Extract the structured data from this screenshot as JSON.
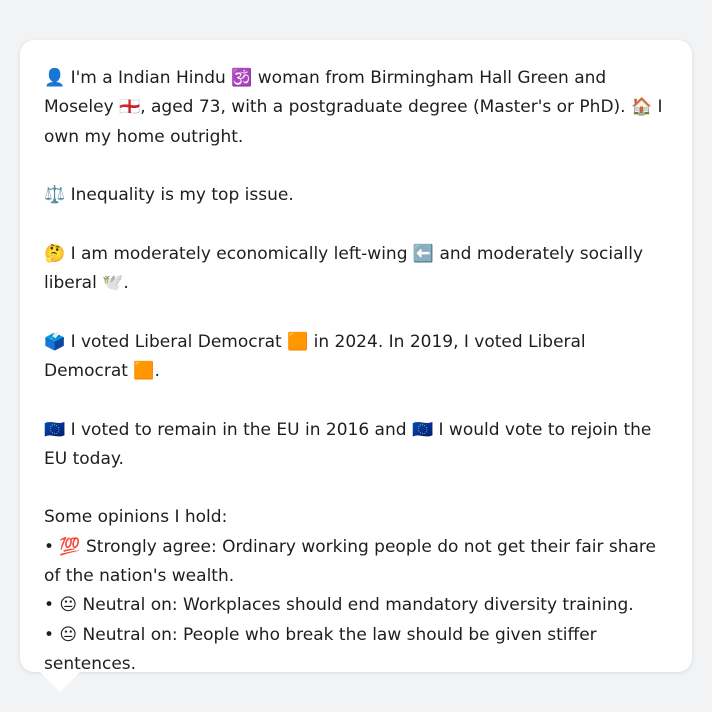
{
  "profile": {
    "identity": "👤 I'm a Indian Hindu 🕉️ woman from Birmingham Hall Green and Moseley 🏴󠁧󠁢󠁥󠁮󠁧󠁿, aged 73, with a postgraduate degree (Master's or PhD). 🏠 I own my home outright.",
    "top_issue": "⚖️ Inequality is my top issue.",
    "ideology": "🤔 I am moderately economically left-wing ⬅️ and moderately socially liberal 🕊️.",
    "voting": "🗳️ I voted Liberal Democrat 🟧 in 2024. In 2019, I voted Liberal Democrat 🟧.",
    "eu": "🇪🇺 I voted to remain in the EU in 2016 and 🇪🇺 I would vote to rejoin the EU today.",
    "opinions_header": "Some opinions I hold:",
    "opinions": [
      "• 💯 Strongly agree: Ordinary working people do not get their fair share of the nation's wealth.",
      "• 😐 Neutral on: Workplaces should end mandatory diversity training.",
      "• 😐 Neutral on: People who break the law should be given stiffer sentences."
    ]
  }
}
